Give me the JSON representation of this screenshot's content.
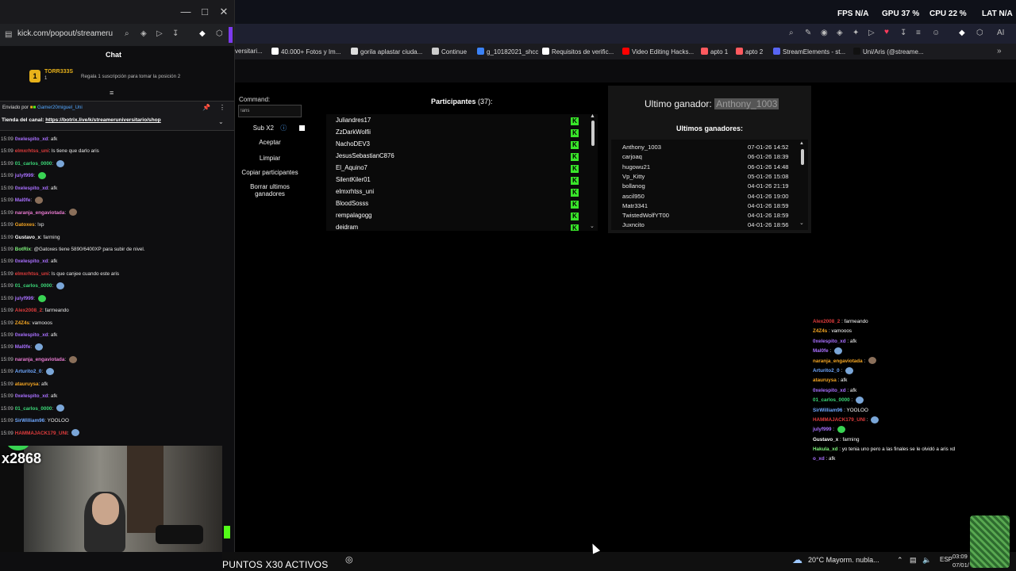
{
  "chat_window": {
    "url": "kick.com/popout/streameruniv",
    "title": "Chat",
    "sub_banner": {
      "user": "TORR333S",
      "count": "1",
      "text": "Regala 1 suscripción para tomar la posición 2"
    },
    "pinned": {
      "label": "Enviado por",
      "user": "Gamer20miguel_Uni",
      "prefix": "Tienda del canal: ",
      "link": "https://botrix.live/k/streameruniversitario/shop"
    },
    "messages": [
      {
        "time": "15:09",
        "user": "0xelespito_xd",
        "color": "#a970ff",
        "text": "afk",
        "emote": ""
      },
      {
        "time": "15:09",
        "user": "elmxrhtss_uni",
        "color": "#e03c3c",
        "text": "ls tiene que darlo aris",
        "emote": ""
      },
      {
        "time": "15:09",
        "user": "01_carlos_0000",
        "color": "#3cd878",
        "text": "",
        "emote": "#7aa6d8"
      },
      {
        "time": "15:09",
        "user": "julyf999",
        "color": "#a970ff",
        "text": "",
        "emote": "#39d353"
      },
      {
        "time": "15:09",
        "user": "0xelespito_xd",
        "color": "#a970ff",
        "text": "afk",
        "emote": ""
      },
      {
        "time": "15:09",
        "user": "Mal0fe",
        "color": "#a970ff",
        "text": "",
        "emote": "#8a6f5a"
      },
      {
        "time": "15:09",
        "user": "naranja_engaviotada",
        "color": "#e87ad0",
        "text": "",
        "emote": "#8a6f5a"
      },
      {
        "time": "15:09",
        "user": "Gatoxes",
        "color": "#f5a623",
        "text": "!xp",
        "emote": ""
      },
      {
        "time": "15:09",
        "user": "Gustavo_x",
        "color": "#ffffff",
        "text": "farming",
        "emote": ""
      },
      {
        "time": "15:09",
        "user": "BotRix",
        "color": "#7ef07a",
        "text": "@Gatoxes tiene 5890/6400XP para subir de nivel.",
        "emote": ""
      },
      {
        "time": "15:09",
        "user": "0xelespito_xd",
        "color": "#a970ff",
        "text": "afk",
        "emote": ""
      },
      {
        "time": "15:09",
        "user": "elmxrhtss_uni",
        "color": "#e03c3c",
        "text": "ls que canjee cuando este aris",
        "emote": ""
      },
      {
        "time": "15:09",
        "user": "01_carlos_0000",
        "color": "#3cd878",
        "text": "",
        "emote": "#7aa6d8"
      },
      {
        "time": "15:09",
        "user": "julyf999",
        "color": "#a970ff",
        "text": "",
        "emote": "#39d353"
      },
      {
        "time": "15:09",
        "user": "Alex2008_2",
        "color": "#e03c3c",
        "text": "farmeando",
        "emote": ""
      },
      {
        "time": "15:09",
        "user": "Z4Z4s",
        "color": "#f5a623",
        "text": "vamooos",
        "emote": ""
      },
      {
        "time": "15:09",
        "user": "0xelespito_xd",
        "color": "#a970ff",
        "text": "afk",
        "emote": ""
      },
      {
        "time": "15:09",
        "user": "Mal0fe",
        "color": "#a970ff",
        "text": "",
        "emote": "#7aa6d8"
      },
      {
        "time": "15:09",
        "user": "naranja_engaviotada",
        "color": "#e87ad0",
        "text": "",
        "emote": "#8a6f5a"
      },
      {
        "time": "15:09",
        "user": "Arturito2_0",
        "color": "#6fa8ff",
        "text": "",
        "emote": "#7aa6d8"
      },
      {
        "time": "15:09",
        "user": "atauruysa",
        "color": "#f5a623",
        "text": "afk",
        "emote": ""
      },
      {
        "time": "15:09",
        "user": "0xelespito_xd",
        "color": "#a970ff",
        "text": "afk",
        "emote": ""
      },
      {
        "time": "15:09",
        "user": "01_carlos_0000",
        "color": "#3cd878",
        "text": "",
        "emote": "#7aa6d8"
      },
      {
        "time": "15:09",
        "user": "SirWilliam96",
        "color": "#6fa8ff",
        "text": "YOOLOO",
        "emote": ""
      },
      {
        "time": "15:09",
        "user": "HAMMAJACK179_UNI",
        "color": "#e03c3c",
        "text": "",
        "emote": "#7aa6d8"
      }
    ],
    "webcam_overlay": "x2868"
  },
  "osd": {
    "fps_label": "FPS",
    "fps_value": "N/A",
    "gpu_label": "GPU",
    "gpu_value": "37 %",
    "cpu_label": "CPU",
    "cpu_value": "22 %",
    "lat_label": "LAT",
    "lat_value": "N/A"
  },
  "bookmarks": [
    "versitari...",
    "40.000+ Fotos y Im...",
    "gorila aplastar ciuda...",
    "Continue",
    "g_10182021_shcc",
    "Requisitos de verific...",
    "Video Editing Hacks...",
    "apto 1",
    "apto 2",
    "StreamElements - st...",
    "Uni/Aris (@streame..."
  ],
  "giveaway": {
    "command_label": "Command:",
    "command_value": "!aris",
    "sub_label": "Sub X2",
    "buttons": [
      "Aceptar",
      "Limpiar",
      "Copiar participantes",
      "Borrar ultimos ganadores"
    ],
    "participants_label": "Participantes",
    "participants_count": "(37):",
    "participants": [
      "Juliandres17",
      "ZzDarkWolfii",
      "NachoDEV3",
      "JesusSebastianC876",
      "El_Aquino7",
      "SilentKiler01",
      "elmxrhtss_uni",
      "BloodSosss",
      "rempalagogg",
      "deidram"
    ],
    "last_winner_label": "Ultimo ganador:",
    "last_winner": "Anthony_1003",
    "winners_title": "Ultimos ganadores:",
    "winners": [
      {
        "name": "Anthony_1003",
        "date": "07-01-26 14:52"
      },
      {
        "name": "carjoaq",
        "date": "06-01-26 18:39"
      },
      {
        "name": "hugowu21",
        "date": "06-01-26 14:48"
      },
      {
        "name": "Vp_Kitty",
        "date": "05-01-26 15:08"
      },
      {
        "name": "bollanog",
        "date": "04-01-26 21:19"
      },
      {
        "name": "ascil950",
        "date": "04-01-26 19:00"
      },
      {
        "name": "Matr3341",
        "date": "04-01-26 18:59"
      },
      {
        "name": "TwistedWolfYT00",
        "date": "04-01-26 18:59"
      },
      {
        "name": "Juxncito",
        "date": "04-01-26 18:56"
      }
    ]
  },
  "overlay_chat": [
    {
      "user": "Alex2008_2",
      "color": "#e03c3c",
      "text": "farmeando",
      "emote": ""
    },
    {
      "user": "Z4Z4s",
      "color": "#f5a623",
      "text": "vamooos",
      "emote": ""
    },
    {
      "user": "0xelespito_xd",
      "color": "#a970ff",
      "text": "afk",
      "emote": ""
    },
    {
      "user": "Mal0fe",
      "color": "#a970ff",
      "text": "",
      "emote": "#7aa6d8"
    },
    {
      "user": "naranja_engaviotada",
      "color": "#f5a623",
      "text": "",
      "emote": "#8a6f5a"
    },
    {
      "user": "Arturito2_0",
      "color": "#6fa8ff",
      "text": "",
      "emote": "#7aa6d8"
    },
    {
      "user": "atauruysa",
      "color": "#f5a623",
      "text": "afk",
      "emote": ""
    },
    {
      "user": "0xelespito_xd",
      "color": "#a970ff",
      "text": "afk",
      "emote": ""
    },
    {
      "user": "01_carlos_0000",
      "color": "#3cd878",
      "text": "",
      "emote": "#7aa6d8"
    },
    {
      "user": "SirWilliam96",
      "color": "#6fa8ff",
      "text": "YOOLOO",
      "emote": ""
    },
    {
      "user": "HAMMAJACK179_UNI",
      "color": "#e03c3c",
      "text": "",
      "emote": "#7aa6d8"
    },
    {
      "user": "julyf999",
      "color": "#a970ff",
      "text": "",
      "emote": "#39d353"
    },
    {
      "user": "Gustavo_x",
      "color": "#ffffff",
      "text": "farming",
      "emote": ""
    },
    {
      "user": "Hakula_xd",
      "color": "#7ef07a",
      "text": "yo tenia uno pero a las finales se le olvidó a aris xd",
      "emote": ""
    },
    {
      "user": "o_xd",
      "color": "#a970ff",
      "text": "afk",
      "emote": ""
    }
  ],
  "taskbar": {
    "banner": "PUNTOS X30 ACTIVOS",
    "weather": "20°C  Mayorm. nubla...",
    "lang": "ESP",
    "time": "03:09",
    "date": "07/01/"
  },
  "colors": {
    "kick_green": "#53fc18",
    "bg": "#0e0e10"
  }
}
